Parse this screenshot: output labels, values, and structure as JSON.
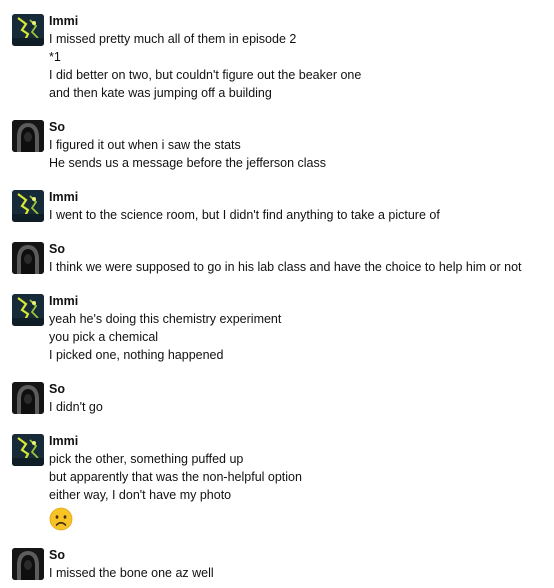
{
  "messages": [
    {
      "author": "Immi",
      "lines": [
        "I missed pretty much all of them in episode 2",
        "*1",
        "I did better on two, but couldn't figure out the beaker one",
        "and then kate was jumping off a building"
      ]
    },
    {
      "author": "So",
      "lines": [
        "I figured it out when i saw the stats",
        "He sends us a message before the jefferson class"
      ]
    },
    {
      "author": "Immi",
      "lines": [
        "I went to the science room, but I didn't find anything to take a picture of"
      ]
    },
    {
      "author": "So",
      "lines": [
        "I think we were supposed to go in his lab class and have the choice to help him or not"
      ]
    },
    {
      "author": "Immi",
      "lines": [
        "yeah he's doing this chemistry experiment",
        "you pick a chemical",
        "I picked one, nothing happened"
      ]
    },
    {
      "author": "So",
      "lines": [
        "I didn't go"
      ]
    },
    {
      "author": "Immi",
      "lines": [
        "pick the other, something puffed up",
        "but apparently that was the non-helpful option",
        "either way, I don't have my photo"
      ],
      "emoji": "sad-face-emoji"
    },
    {
      "author": "So",
      "lines": [
        "I missed the bone one az well"
      ]
    }
  ],
  "icons": {
    "immi_avatar": "avatar-immi-icon",
    "so_avatar": "avatar-so-icon"
  }
}
